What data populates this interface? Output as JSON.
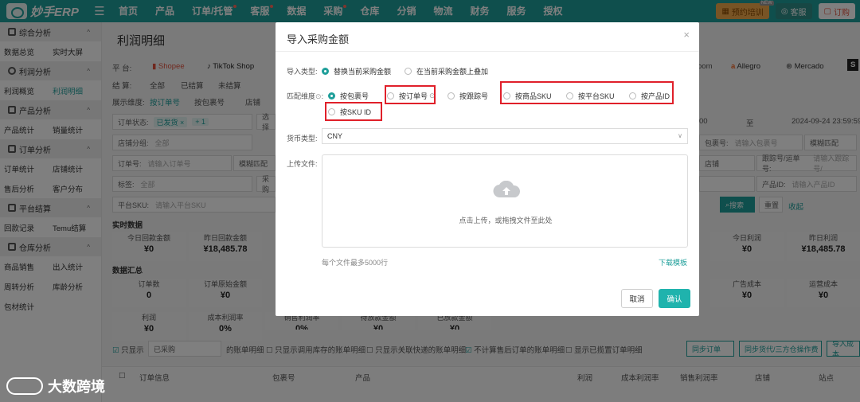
{
  "app": {
    "logo": "妙手ERP"
  },
  "nav": [
    "首页",
    "产品",
    "订单/托管",
    "客服",
    "数据",
    "采购",
    "仓库",
    "分销",
    "物流",
    "财务",
    "服务",
    "授权"
  ],
  "top_right": {
    "shop": "预约培训",
    "new_tag": "NEW",
    "service": "客服",
    "order": "订购"
  },
  "sidebar": {
    "groups": [
      {
        "title": "综合分析",
        "items": [
          "数据总览",
          "实时大屏"
        ]
      },
      {
        "title": "利润分析",
        "items": [
          "利润概览",
          "利润明细"
        ]
      },
      {
        "title": "产品分析",
        "items": [
          "产品统计",
          "销量统计"
        ]
      },
      {
        "title": "订单分析",
        "items": [
          "订单统计",
          "店铺统计",
          "售后分析",
          "客户分布"
        ]
      },
      {
        "title": "平台结算",
        "items": [
          "回款记录",
          "Temu结算"
        ]
      },
      {
        "title": "仓库分析",
        "items": [
          "商品销售",
          "出入统计",
          "周转分析",
          "库龄分析",
          "包材统计"
        ]
      }
    ]
  },
  "page": {
    "title": "利润明细",
    "platform_label": "平    台:",
    "platforms": [
      "Shopee",
      "TikTok Shop",
      "oom",
      "Allegro",
      "Mercado"
    ],
    "settle_label": "结    算:",
    "settle_opts": [
      "全部",
      "已结算",
      "未结算"
    ],
    "dim_label": "展示维度:",
    "dim_opts": [
      "按订单号",
      "按包裹号",
      "店铺"
    ],
    "filters": {
      "order_status": "订单状态:",
      "order_status_tag": "已发货 ×",
      "order_status_more": "+ 1",
      "select": "选择",
      "shop_group": "店铺分组:",
      "shop_group_val": "全部",
      "order_no": "订单号:",
      "order_no_ph": "请输入订单号",
      "fuzzy": "模糊匹配",
      "tag": "标签:",
      "tag_val": "全部",
      "purchase": "采购",
      "platform_sku": "平台SKU:",
      "platform_sku_ph": "请输入平台SKU",
      "date_end": "2024-09-24 23:59:59",
      "date_from_tail": "00",
      "to": "至",
      "pkg_no": "包裹号:",
      "pkg_no_ph": "请输入包裹号",
      "fuzzy2": "模糊匹配",
      "shop": "店铺",
      "tracking": "跟踪号/运单号:",
      "tracking_ph": "请输入跟踪号/",
      "product_id": "产品ID:",
      "product_id_ph": "请输入产品ID",
      "search": "搜索",
      "reset": "重置",
      "collapse": "收起"
    },
    "realtime_title": "实时数据",
    "realtime_left": [
      {
        "label": "今日回款金额",
        "value": "¥0"
      },
      {
        "label": "昨日回款金额",
        "value": "¥18,485.78"
      }
    ],
    "realtime_right": [
      {
        "label": "今日利润",
        "value": "¥0"
      },
      {
        "label": "昨日利润",
        "value": "¥18,485.78"
      }
    ],
    "summary_title": "数据汇总",
    "summary_left": [
      {
        "label": "订单数",
        "value": "0"
      },
      {
        "label": "订单原始金额",
        "value": "¥0"
      },
      {
        "label": "利润",
        "value": "¥0"
      },
      {
        "label": "成本利润率",
        "value": "0%"
      }
    ],
    "summary_mid": [
      {
        "label": "销售利润率",
        "value": "0%"
      },
      {
        "label": "待放款金额",
        "value": "¥0"
      },
      {
        "label": "已放款金额",
        "value": "¥0"
      }
    ],
    "summary_right": [
      {
        "label": "广告成本",
        "value": "¥0"
      },
      {
        "label": "运营成本",
        "value": "¥0"
      }
    ],
    "options": {
      "only_show": "只显示",
      "only_show_val": "已采购",
      "bill_detail": "的账单明细",
      "opt2": "只显示调用库存的账单明细",
      "opt3": "只显示关联快递的账单明细",
      "opt4": "不计算售后订单的账单明细",
      "opt5": "显示已揽置订单明细",
      "sync_order": "同步订单",
      "sync_3pl": "同步货代/三方仓操作费",
      "import": "导入成本"
    },
    "table_headers": [
      "订单信息",
      "包裹号",
      "产品",
      "利润",
      "成本利润率",
      "销售利润率",
      "店铺",
      "站点"
    ]
  },
  "modal": {
    "title": "导入采购金额",
    "import_type_label": "导入类型:",
    "import_types": [
      {
        "label": "替换当前采购金额",
        "checked": true
      },
      {
        "label": "在当前采购金额上叠加",
        "checked": false
      }
    ],
    "match_label": "匹配维度",
    "match_opts": [
      {
        "label": "按包裹号",
        "checked": true
      },
      {
        "label": "按订单号",
        "checked": false
      },
      {
        "label": "按跟踪号",
        "checked": false
      },
      {
        "label": "按商品SKU",
        "checked": false
      },
      {
        "label": "按平台SKU",
        "checked": false
      },
      {
        "label": "按产品ID",
        "checked": false
      },
      {
        "label": "按SKU ID",
        "checked": false
      }
    ],
    "currency_label": "货币类型:",
    "currency_value": "CNY",
    "upload_label": "上传文件:",
    "upload_hint": "点击上传，或拖拽文件至此处",
    "file_limit": "每个文件最多5000行",
    "download_template": "下载模板",
    "cancel": "取消",
    "confirm": "确认",
    "highlight_color": "#e0202a",
    "accent_color": "#1f9f9a"
  },
  "watermark": "大数跨境"
}
